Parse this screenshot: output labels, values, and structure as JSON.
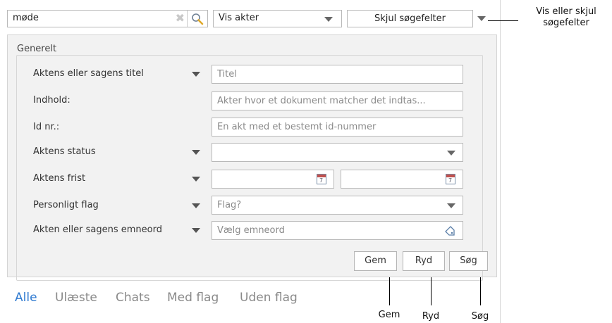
{
  "search": {
    "value": "møde"
  },
  "view_select": {
    "value": "Vis akter"
  },
  "toggle_button": {
    "label": "Skjul søgefelter"
  },
  "fieldset": {
    "title": "Generelt"
  },
  "fields": [
    {
      "label": "Aktens eller sagens titel",
      "placeholder": "Titel"
    },
    {
      "label": "Indhold:",
      "placeholder": "Akter hvor et dokument matcher det indtas..."
    },
    {
      "label": "Id nr.:",
      "placeholder": "En akt med et bestemt id-nummer"
    },
    {
      "label": "Aktens status",
      "placeholder": ""
    },
    {
      "label": "Aktens frist",
      "placeholder": ""
    },
    {
      "label": "Personligt flag",
      "placeholder": "Flag?"
    },
    {
      "label": "Akten eller sagens emneord",
      "placeholder": "Vælg emneord"
    }
  ],
  "buttons": {
    "gem": "Gem",
    "ryd": "Ryd",
    "sog": "Søg"
  },
  "tabs": [
    {
      "label": "Alle",
      "active": true
    },
    {
      "label": "Ulæste",
      "active": false
    },
    {
      "label": "Chats",
      "active": false
    },
    {
      "label": "Med flag",
      "active": false
    },
    {
      "label": "Uden flag",
      "active": false
    }
  ],
  "annotations": {
    "toggle_line1": "Vis eller skjul",
    "toggle_line2": "søgefelter",
    "gem": "Gem",
    "ryd": "Ryd",
    "sog": "Søg"
  },
  "colors": {
    "active_tab": "#2f7ad0",
    "inactive_tab": "#8a8a8a",
    "panel_bg": "#f2f2f2"
  },
  "icons": {
    "clear": "close-icon",
    "search": "magnifier-icon",
    "date": "calendar-icon",
    "keywords": "tag-icon"
  }
}
